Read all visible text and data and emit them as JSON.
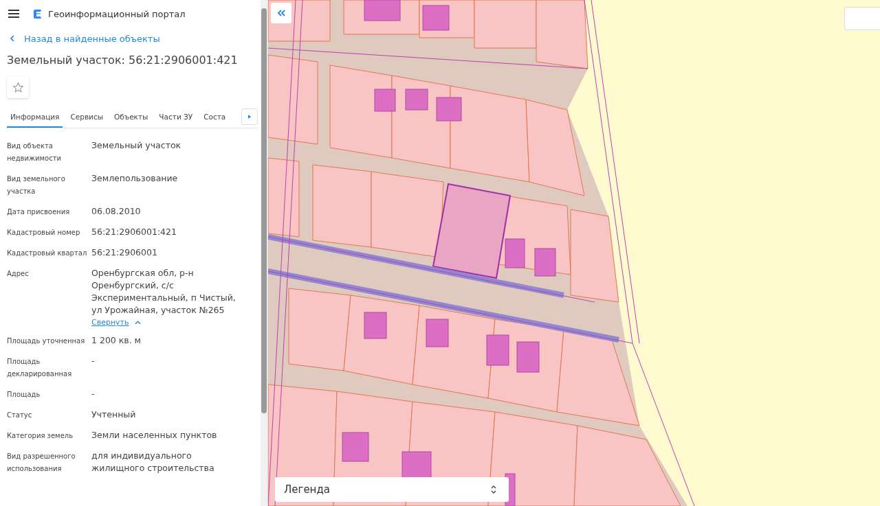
{
  "header": {
    "title": "Геоинформационный портал"
  },
  "back_link": "Назад в найденные объекты",
  "object_title": "Земельный участок: 56:21:2906001:421",
  "tabs": [
    {
      "label": "Информация",
      "selected": true
    },
    {
      "label": "Сервисы",
      "selected": false
    },
    {
      "label": "Объекты",
      "selected": false
    },
    {
      "label": "Части ЗУ",
      "selected": false
    },
    {
      "label": "Соста",
      "selected": false
    }
  ],
  "fields": [
    {
      "label": "Вид объекта недвижимости",
      "value": "Земельный участок"
    },
    {
      "label": "Вид земельного участка",
      "value": "Землепользование"
    },
    {
      "label": "Дата присвоения",
      "value": "06.08.2010"
    },
    {
      "label": "Кадастровый номер",
      "value": "56:21:2906001:421"
    },
    {
      "label": "Кадастровый квартал",
      "value": "56:21:2906001"
    },
    {
      "label": "Адрес",
      "value": "Оренбургская обл, р-н Оренбургский, с/с Экспериментальный, п Чистый, ул Урожайная, участок №265",
      "toggle": "Свернуть"
    },
    {
      "label": "Площадь уточненная",
      "value": "1 200 кв. м"
    },
    {
      "label": "Площадь декларированная",
      "value": "-"
    },
    {
      "label": "Площадь",
      "value": "-"
    },
    {
      "label": "Статус",
      "value": "Учтенный"
    },
    {
      "label": "Категория земель",
      "value": "Земли населенных пунктов"
    },
    {
      "label": "Вид разрешенного использования",
      "value": "для индивидуального жилищного строительства"
    }
  ],
  "map": {
    "legend": "Легенда"
  }
}
